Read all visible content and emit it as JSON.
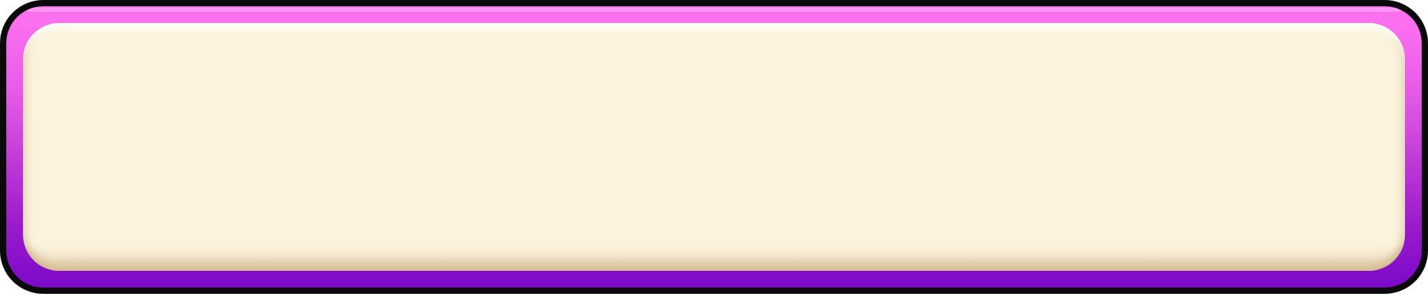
{
  "panel": {
    "text": ""
  },
  "colors": {
    "border": "#0a0a0a",
    "frame_top": "#ff72ee",
    "frame_bottom": "#7b0ac8",
    "panel_fill": "#fcf3dd"
  }
}
